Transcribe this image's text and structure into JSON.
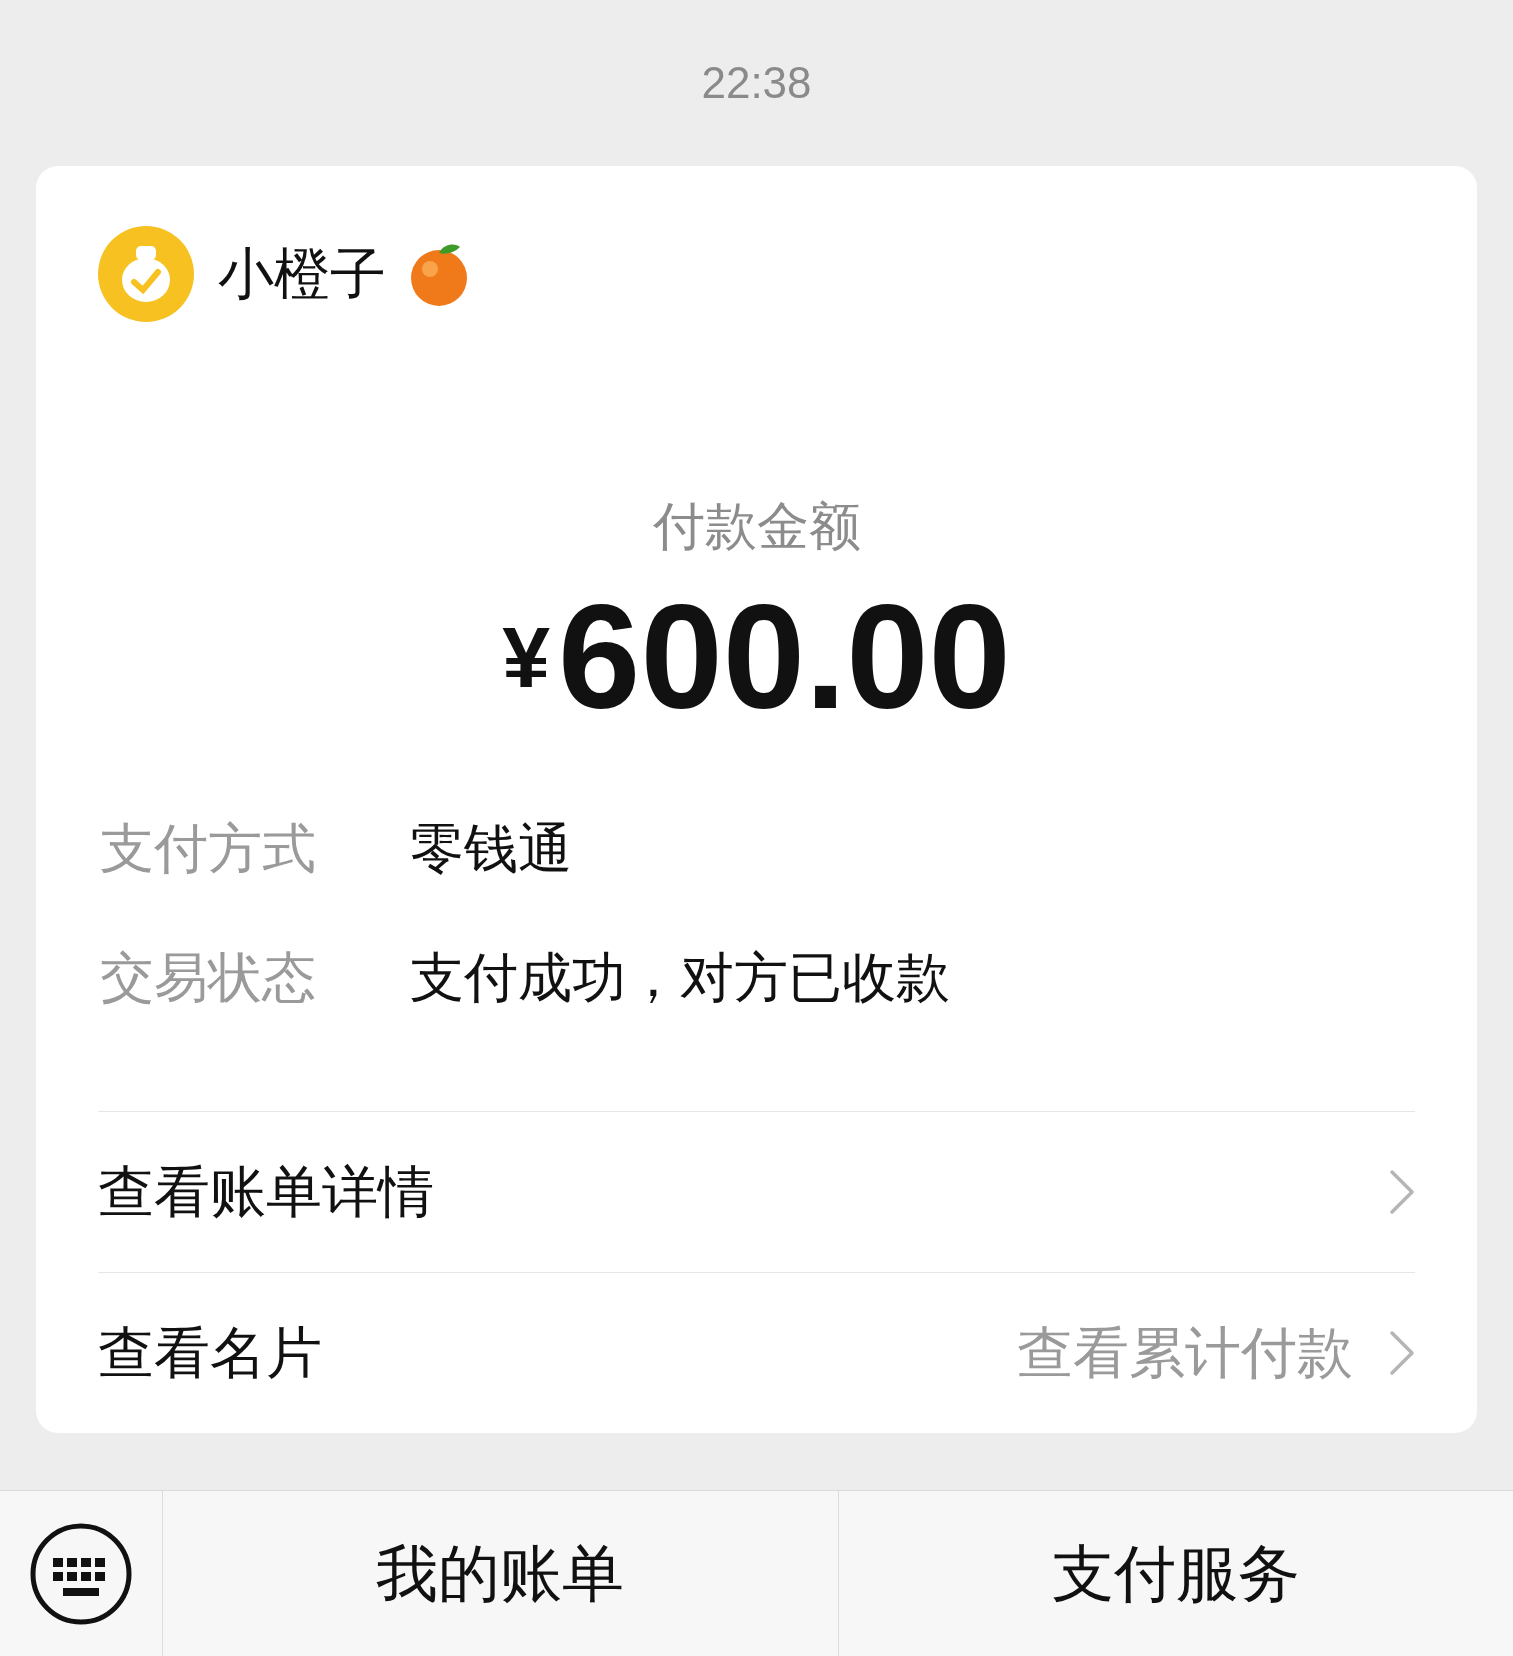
{
  "time": "22:38",
  "card": {
    "merchant": "小橙子",
    "amount_label": "付款金额",
    "currency": "¥",
    "amount": "600.00",
    "details": [
      {
        "label": "支付方式",
        "value": "零钱通"
      },
      {
        "label": "交易状态",
        "value": "支付成功，对方已收款"
      }
    ],
    "links": [
      {
        "label": "查看账单详情"
      },
      {
        "label": "查看名片",
        "hint": "查看累计付款"
      }
    ]
  },
  "bottom_menu": [
    "我的账单",
    "支付服务"
  ]
}
